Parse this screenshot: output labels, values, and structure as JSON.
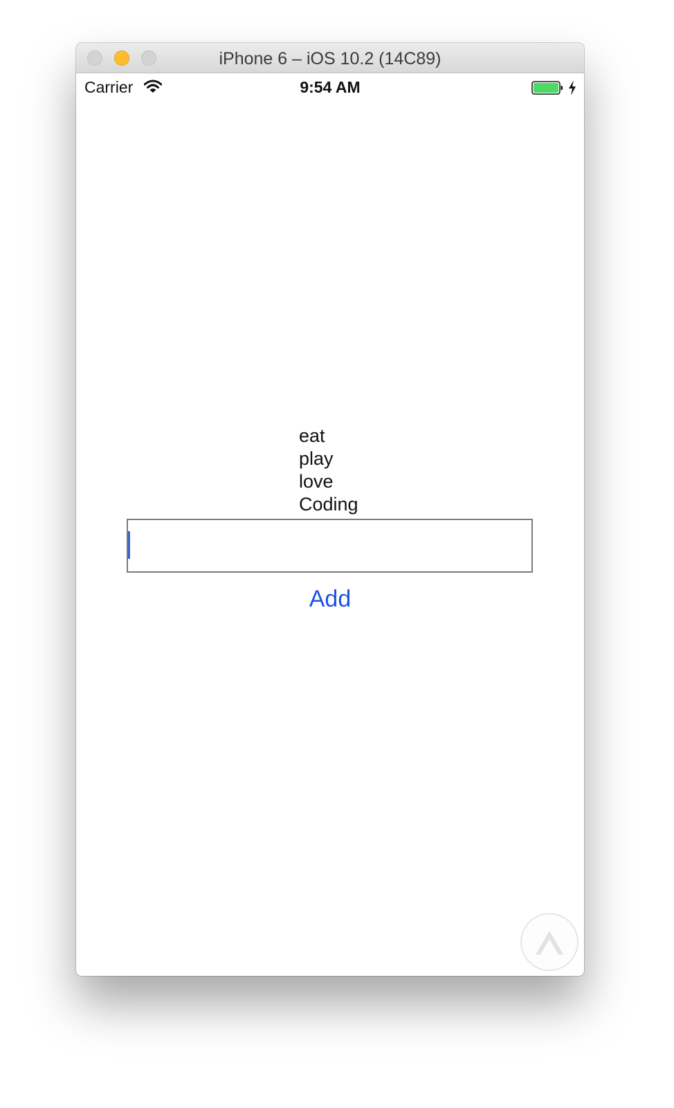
{
  "window": {
    "title": "iPhone 6 – iOS 10.2 (14C89)"
  },
  "status_bar": {
    "carrier": "Carrier",
    "time": "9:54 AM",
    "battery_color": "#4cd964"
  },
  "main": {
    "items": [
      "eat",
      "play",
      "love",
      "Coding"
    ],
    "input_value": "",
    "add_label": "Add",
    "add_color": "#1f52e6"
  }
}
